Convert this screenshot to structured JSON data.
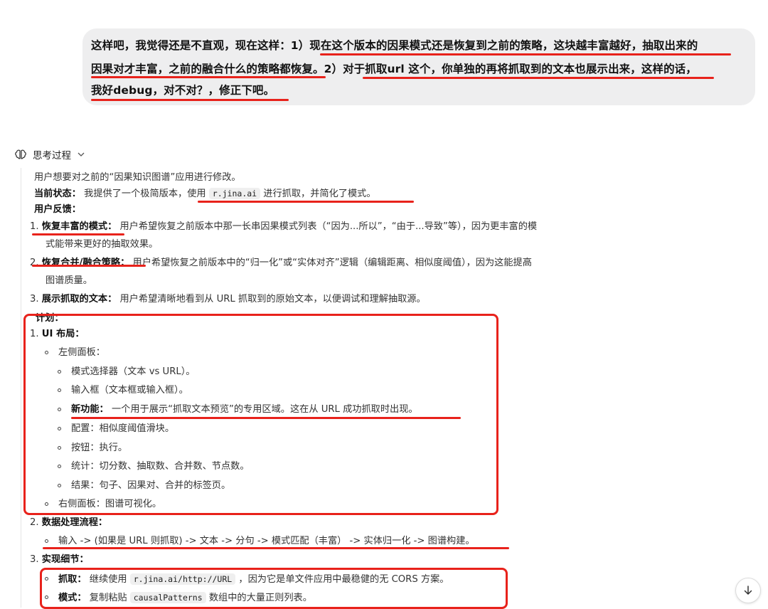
{
  "user_message": {
    "lines": [
      "这样吧，我觉得还是不直观，现在这样：1）现在这个版本的因果模式还是恢复到之前的策略，这块越丰富越好，抽取出来的",
      "因果对才丰富，之前的融合什么的策略都恢复。2）对于抓取url 这个，你单独的再将抓取到的文本也展示出来，这样的话，",
      "我好debug，对不对？，修正下吧。"
    ]
  },
  "thinking": {
    "title": "思考过程",
    "intro": "用户想要对之前的“因果知识图谱”应用进行修改。",
    "status_label": "当前状态：",
    "status_pre": "我提供了一个极简版本，使用",
    "status_code": "r.jina.ai",
    "status_post": "进行抓取，并简化了模式。",
    "feedback_label": "用户反馈：",
    "feedback": [
      {
        "num": "1.",
        "label": "恢复丰富的模式：",
        "text": "用户希望恢复之前版本中那一长串因果模式列表（“因为...所以”，“由于...导致”等），因为更丰富的模",
        "cont": "式能带来更好的抽取效果。"
      },
      {
        "num": "2.",
        "label": "恢复合并/融合策略：",
        "text": "用户希望恢复之前版本中的“归一化”或“实体对齐”逻辑（编辑距离、相似度阈值），因为这能提高",
        "cont": "图谱质量。"
      },
      {
        "num": "3.",
        "label": "展示抓取的文本：",
        "text": "用户希望清晰地看到从 URL 抓取到的原始文本，以便调试和理解抽取源。"
      }
    ],
    "plan_label": "计划：",
    "plan1_num": "1.",
    "plan1_label": "UI 布局：",
    "left_panel": "左侧面板：",
    "left_items": [
      {
        "text": "模式选择器（文本 vs URL）。"
      },
      {
        "text": "输入框（文本框或输入框）。"
      },
      {
        "label": "新功能：",
        "text": "一个用于展示“抓取文本预览”的专用区域。这在从 URL 成功抓取时出现。"
      },
      {
        "text": "配置：相似度阈值滑块。"
      },
      {
        "text": "按钮：执行。"
      },
      {
        "text": "统计：切分数、抽取数、合并数、节点数。"
      },
      {
        "text": "结果：句子、因果对、合并的标签页。"
      }
    ],
    "right_panel": "右侧面板：图谱可视化。",
    "plan2_num": "2.",
    "plan2_label": "数据处理流程：",
    "plan2_item": "输入 -> (如果是 URL 则抓取) -> 文本 -> 分句 -> 模式匹配（丰富） -> 实体归一化 -> 图谱构建。",
    "plan3_num": "3.",
    "plan3_label": "实现细节：",
    "impl_fetch_label": "抓取：",
    "impl_fetch_pre": "继续使用",
    "impl_fetch_code": "r.jina.ai/http://URL",
    "impl_fetch_post": "，因为它是单文件应用中最稳健的无 CORS 方案。",
    "impl_pattern_label": "模式：",
    "impl_pattern_pre": "复制粘贴",
    "impl_pattern_code": "causalPatterns",
    "impl_pattern_post": "数组中的大量正则列表。"
  },
  "colors": {
    "annotation_red": "#e8221b",
    "bubble_bg": "#eeeeef"
  }
}
